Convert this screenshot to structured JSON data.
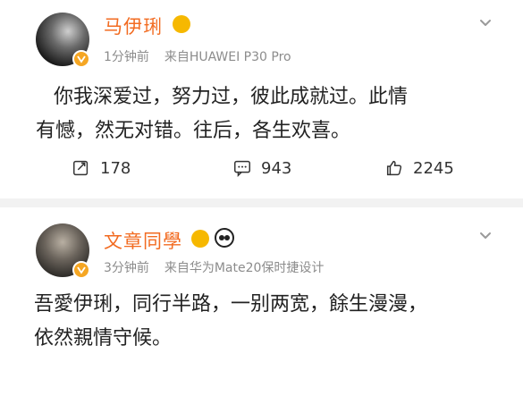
{
  "posts": [
    {
      "author": "马伊琍",
      "time": "1分钟前",
      "source": "来自HUAWEI P30 Pro",
      "content_lines": [
        "你我深爱过，努力过，彼此成就过。此情",
        "有憾，然无对错。往后，各生欢喜。"
      ],
      "actions": {
        "repost": "178",
        "comment": "943",
        "like": "2245"
      }
    },
    {
      "author": "文章同學",
      "time": "3分钟前",
      "source": "来自华为Mate20保时捷设计",
      "content_lines": [
        "吾愛伊琍，同行半路，一别两宽，餘生漫漫，",
        "依然親情守候。"
      ]
    }
  ],
  "colors": {
    "name": "#f26b21",
    "meta": "#8c8c8c",
    "badge": "#f5a623"
  },
  "icons": {
    "verified": "verified-badge-icon",
    "more": "chevron-down-icon",
    "repost": "repost-icon",
    "comment": "comment-icon",
    "like": "thumbs-up-icon"
  }
}
